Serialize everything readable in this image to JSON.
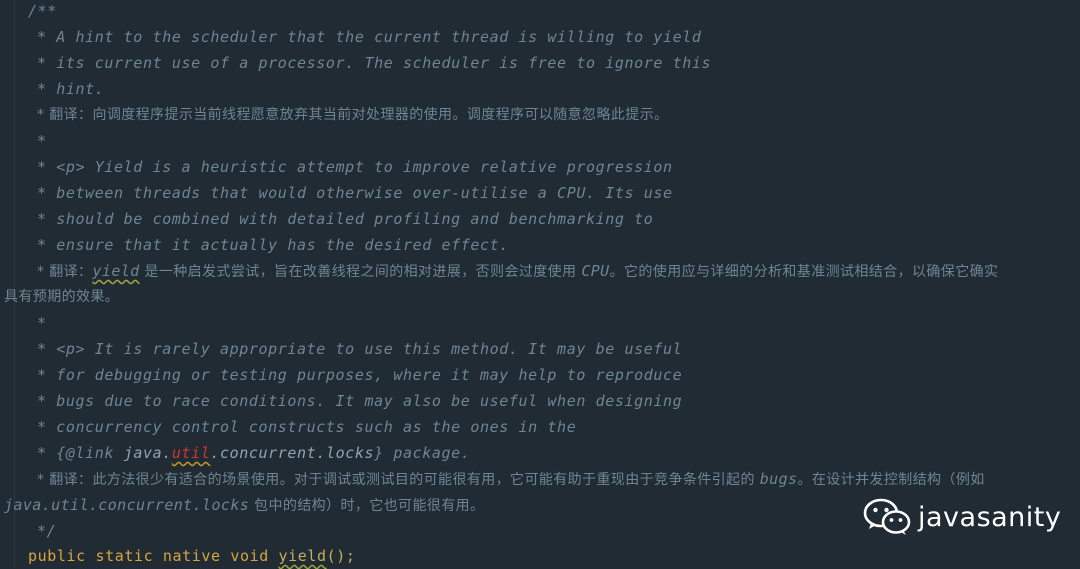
{
  "code": {
    "lines": [
      "/**",
      "* A hint to the scheduler that the current thread is willing to yield",
      "* its current use of a processor. The scheduler is free to ignore this",
      "* hint.",
      "* 翻译：向调度程序提示当前线程愿意放弃其当前对处理器的使用。调度程序可以随意忽略此提示。",
      "*",
      "* <p> Yield is a heuristic attempt to improve relative progression",
      "* between threads that would otherwise over-utilise a CPU. Its use",
      "* should be combined with detailed profiling and benchmarking to",
      "* ensure that it actually has the desired effect.",
      "*",
      "* <p> It is rarely appropriate to use this method. It may be useful",
      "* for debugging or testing purposes, where it may help to reproduce",
      "* bugs due to race conditions. It may also be useful when designing",
      "* concurrency control constructs such as the ones in the",
      "*/"
    ],
    "translation2": {
      "prefix": "* 翻译：",
      "yield": "yield",
      "part1": " 是一种启发式尝试，旨在改善线程之间的相对进展，否则会过度使用 ",
      "cpu": "CPU",
      "part2": "。它的使用应与详细的分析和基准测试相结合，以确保它确实",
      "wrap": "具有预期的效果。"
    },
    "link_line": {
      "prefix": "* {@link ",
      "java": "java.",
      "util": "util",
      "rest": ".concurrent.locks",
      "suffix": "} package."
    },
    "translation3": {
      "prefix": "* 翻译：此方法很少有适合的场景使用。对于调试或测试目的可能很有用，它可能有助于重现由于竞争条件引起的 ",
      "bugs": "bugs",
      "part1": "。在设计并发控制结构（例如",
      "wrap_code": "java.util.concurrent.locks",
      "wrap_text": " 包中的结构）时，它也可能很有用。"
    },
    "signature": {
      "public": "public",
      "static": "static",
      "native": "native",
      "void": "void",
      "name": "yield",
      "parens": "();"
    }
  },
  "watermark": {
    "text": "javasanity",
    "icon": "wechat-icon"
  }
}
